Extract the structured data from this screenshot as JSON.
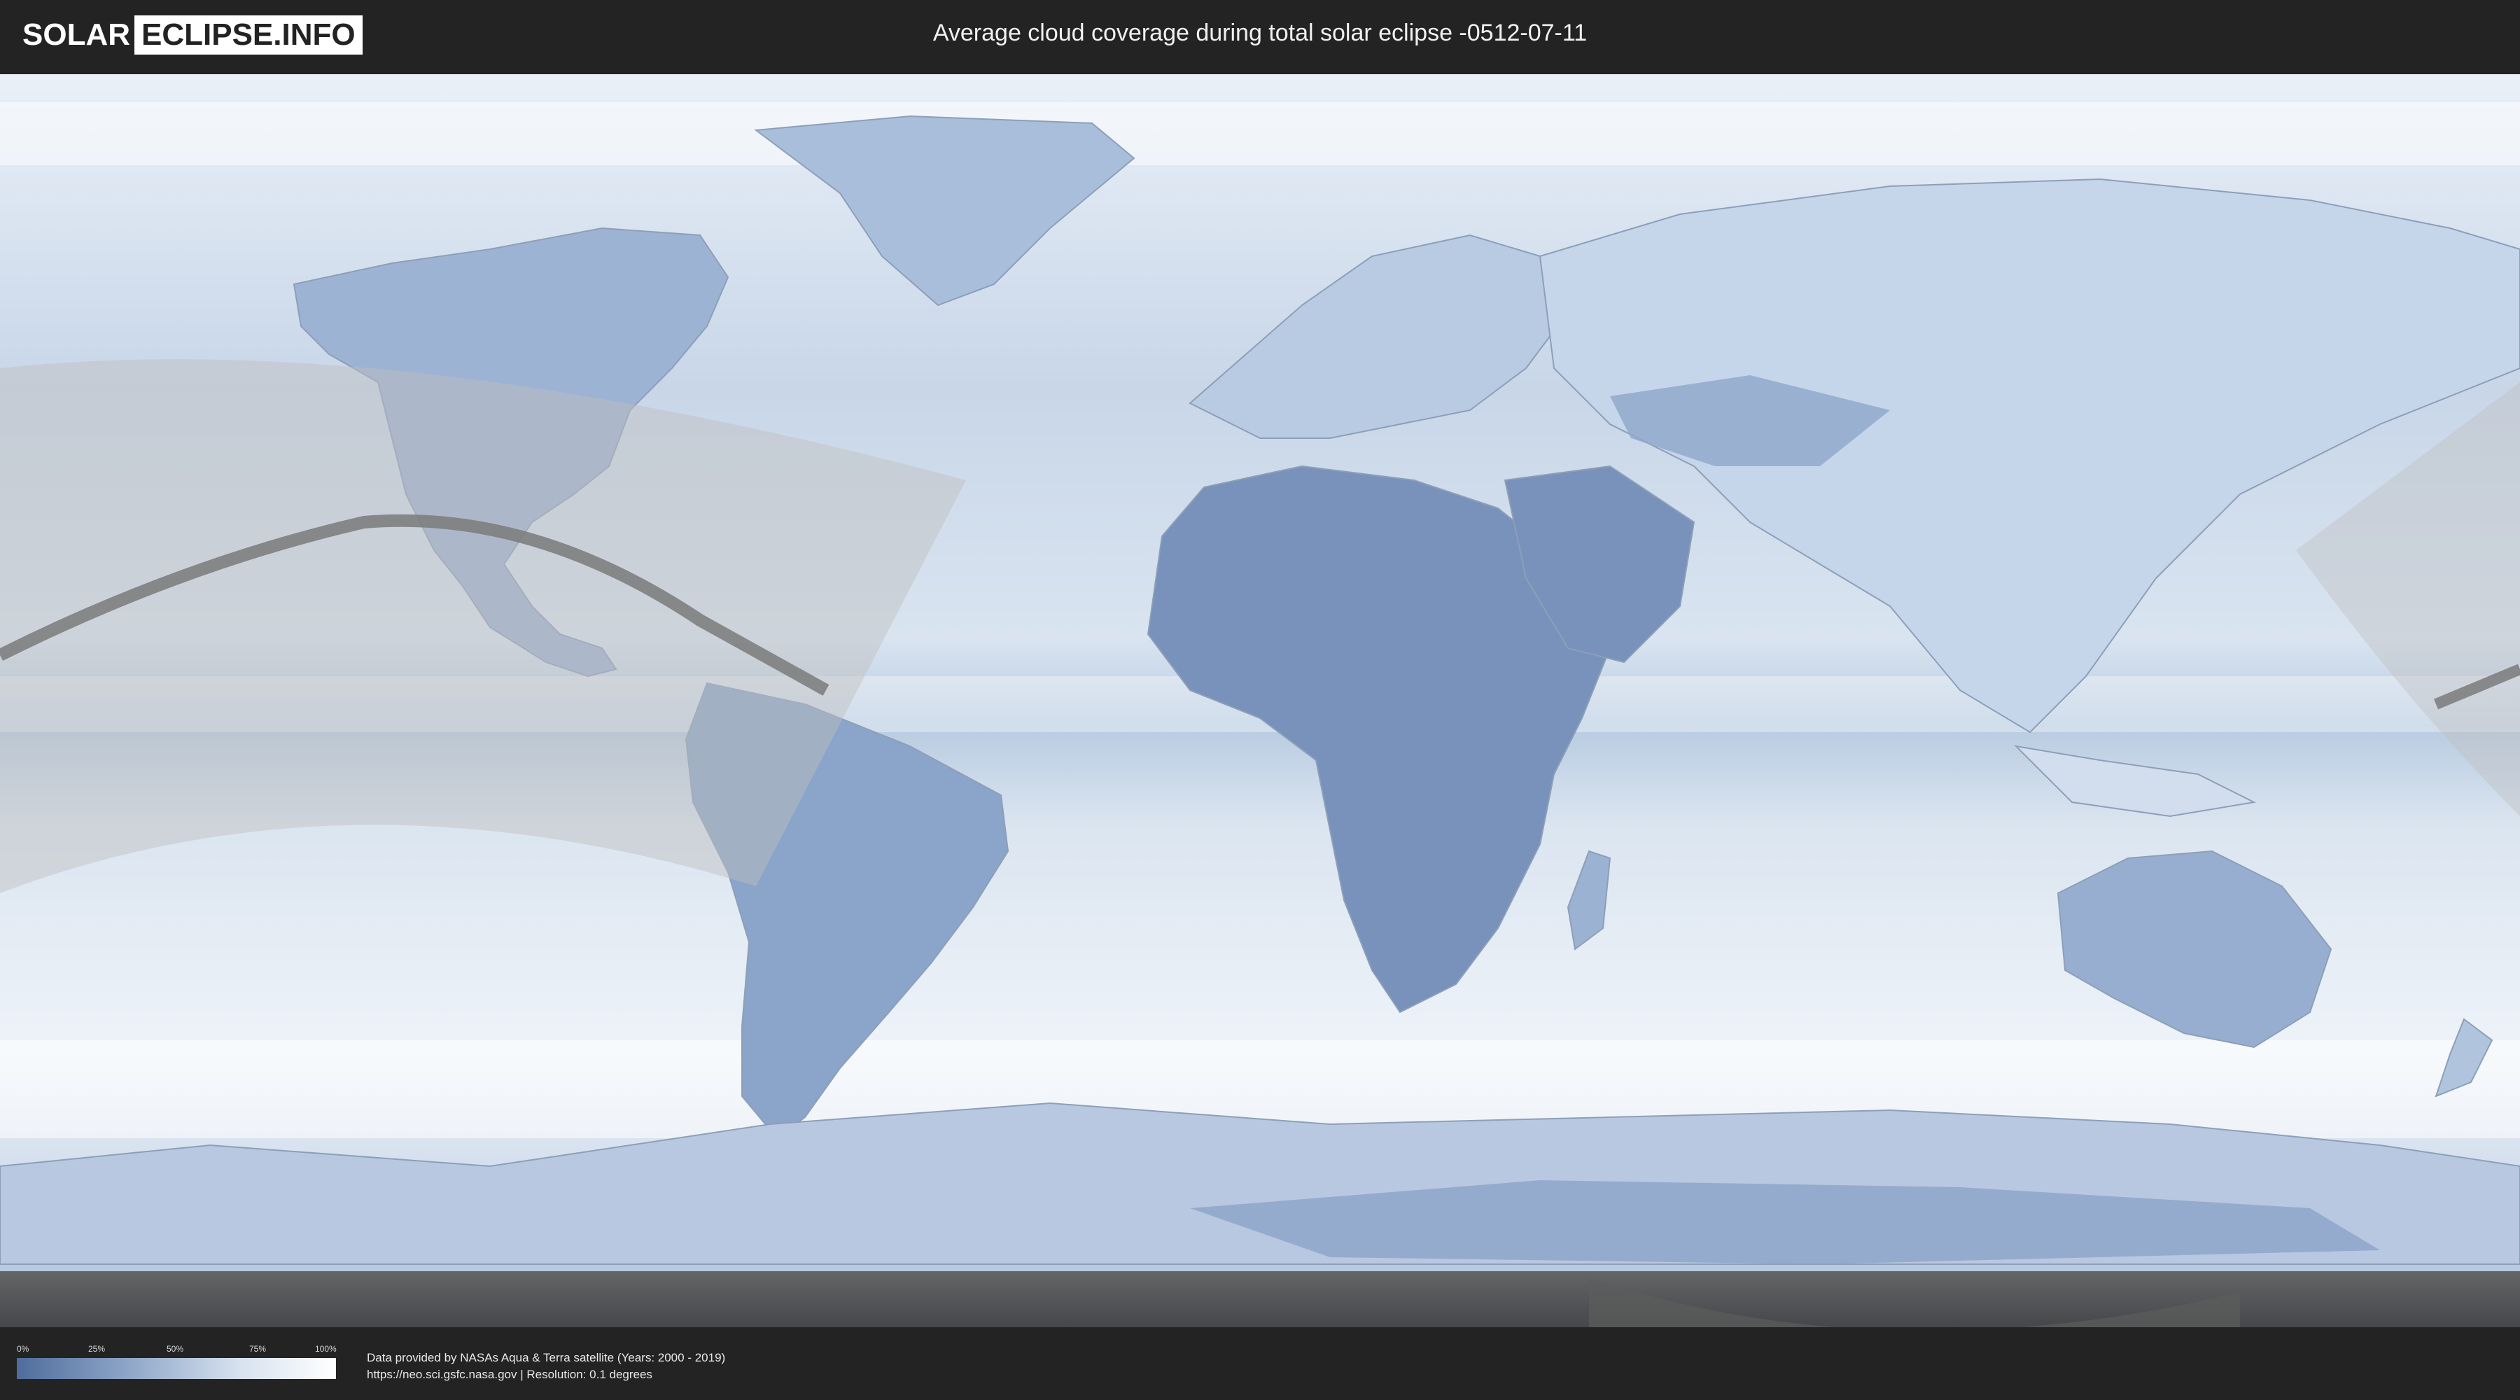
{
  "header": {
    "logo_part1": "SOLAR",
    "logo_part2": "ECLIPSE.INFO",
    "title": "Average cloud coverage during total solar eclipse -0512-07-11"
  },
  "map": {
    "type": "world-cloud-coverage",
    "projection": "equirectangular",
    "colors": {
      "clear_sky": "#4e6c9c",
      "full_cloud": "#ffffff",
      "eclipse_path": "#7a7a7a",
      "night_overlay": "#555555"
    }
  },
  "legend": {
    "ticks": [
      "0%",
      "25%",
      "50%",
      "75%",
      "100%"
    ]
  },
  "footer": {
    "line1": "Data provided by NASAs Aqua & Terra satellite (Years: 2000 - 2019)",
    "line2": "https://neo.sci.gsfc.nasa.gov | Resolution: 0.1 degrees"
  }
}
